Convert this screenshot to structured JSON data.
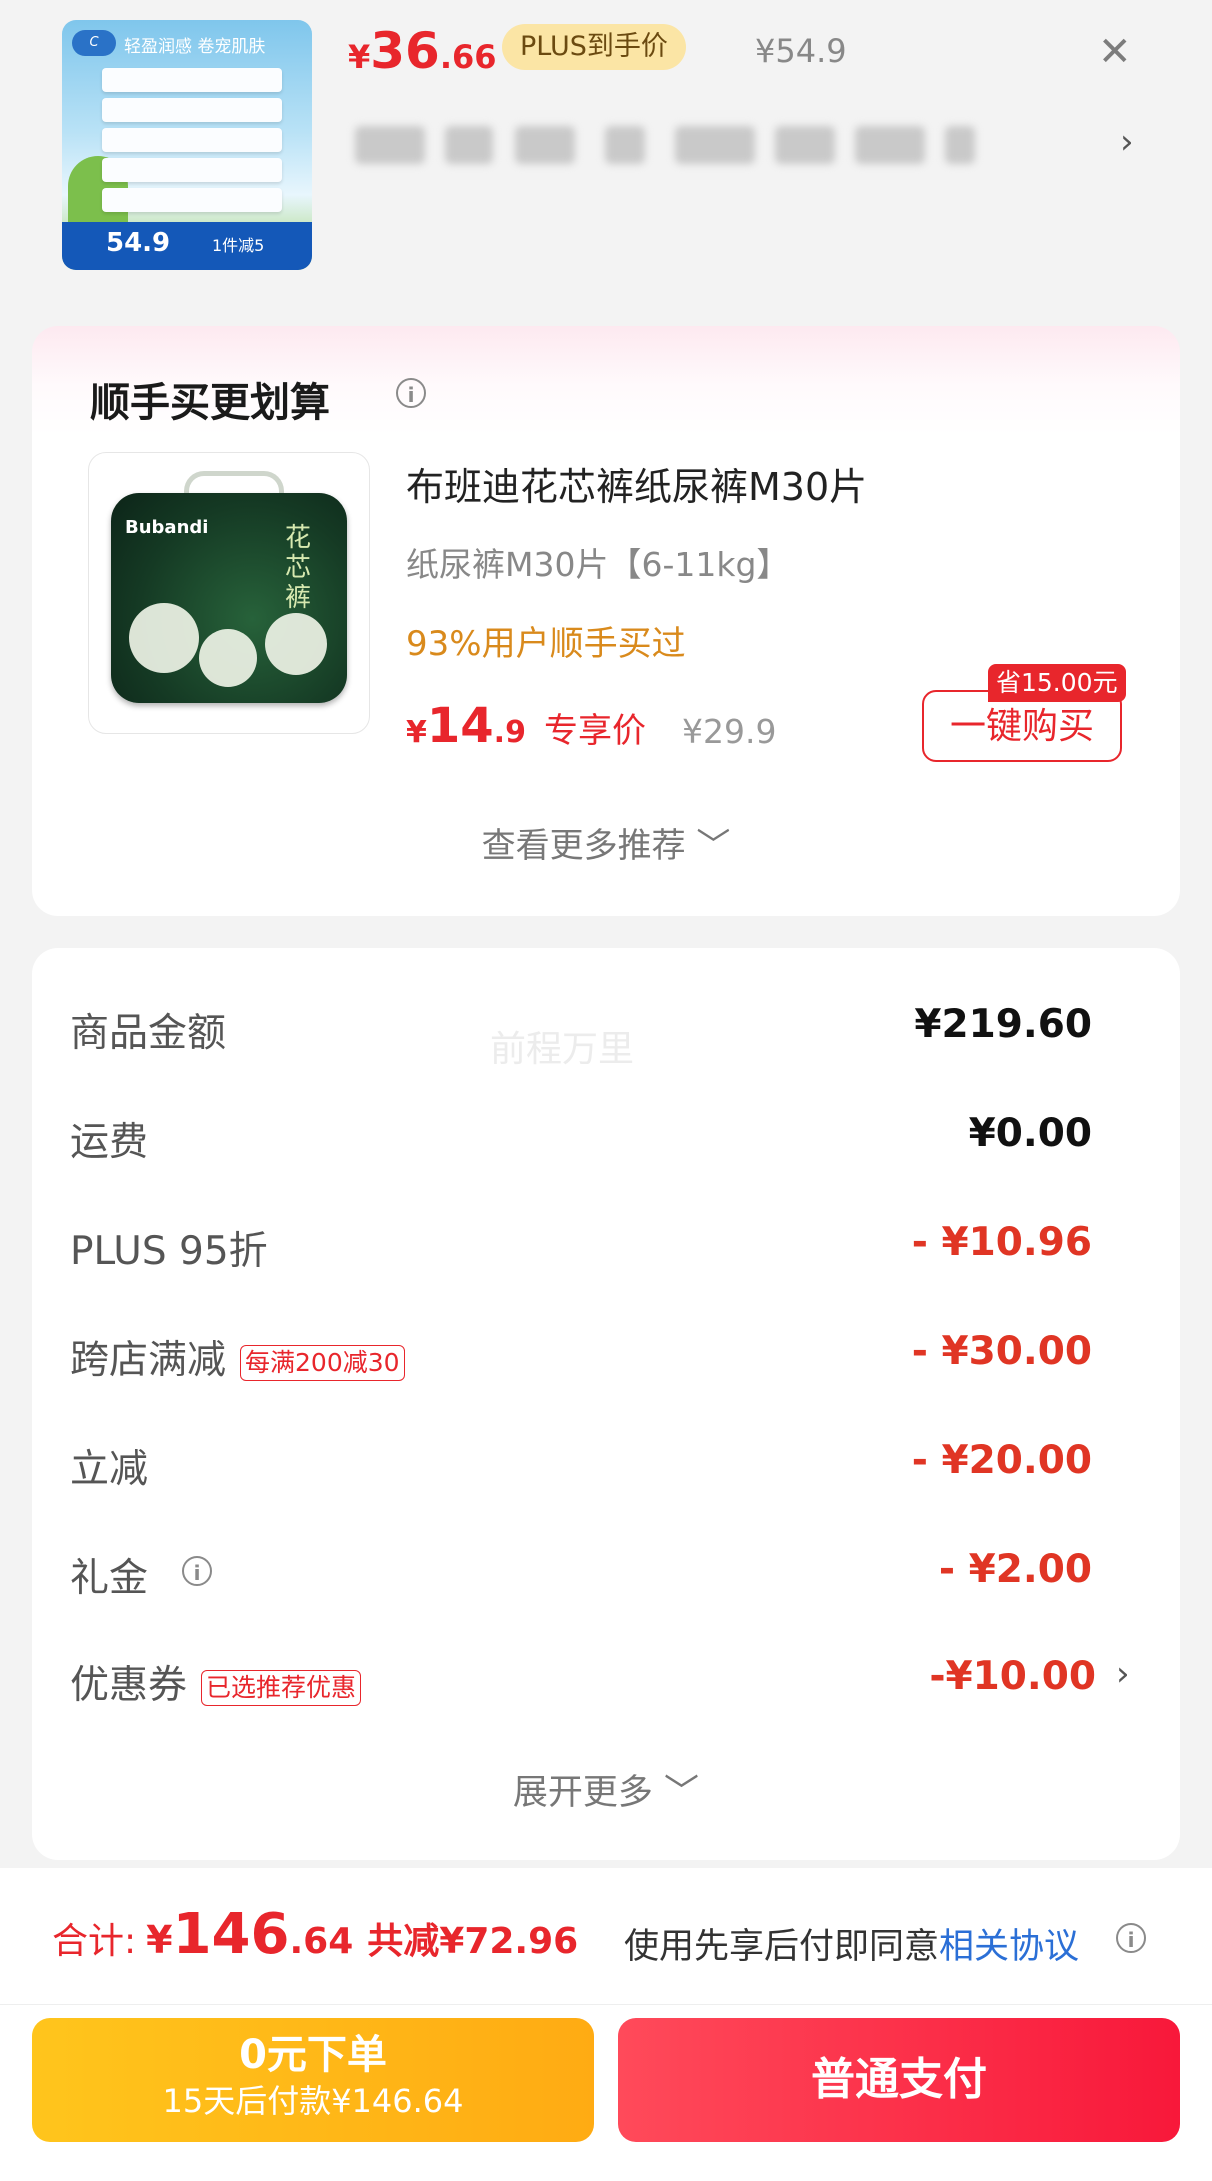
{
  "top_product": {
    "thumb_slogan": "轻盈润感 卷宠肌肤",
    "thumb_price": "54.9",
    "thumb_promo": "1件减5",
    "price_currency": "¥",
    "price_int": "36",
    "price_dec": ".66",
    "plus_badge": "PLUS到手价",
    "orig_price": "¥54.9",
    "close_icon": "close-icon",
    "chevron_icon": "chevron-right-icon"
  },
  "recommend": {
    "title": "顺手买更划算",
    "product_logo": "Bubandi",
    "product_name": "布班迪花芯裤纸尿裤M30片",
    "spec": "纸尿裤M30片【6-11kg】",
    "bought_text": "93%用户顺手买过",
    "price_currency": "¥",
    "price_int": "14",
    "price_dec": ".9",
    "price_label": "专享价",
    "orig_price": "¥29.9",
    "save_tag": "省15.00元",
    "buy_button": "一键购买",
    "see_more": "查看更多推荐 ﹀"
  },
  "summary": {
    "watermark": "前程万里",
    "rows": [
      {
        "label": "商品金额",
        "value": "¥219.60"
      },
      {
        "label": "运费",
        "value": "¥0.00"
      },
      {
        "label": "PLUS 95折",
        "value": "- ¥10.96"
      },
      {
        "label": "跨店满减",
        "tag": "每满200减30",
        "value": "- ¥30.00"
      },
      {
        "label": "立减",
        "value": "- ¥20.00"
      },
      {
        "label": "礼金",
        "value": "- ¥2.00"
      },
      {
        "label": "优惠券",
        "tag": "已选推荐优惠",
        "value": "-¥10.00"
      }
    ],
    "expand_more": "展开更多 ﹀"
  },
  "footer": {
    "total_label": "合计:",
    "total_currency": "¥",
    "total_int": "146",
    "total_dec": ".64",
    "total_saved": "共减¥72.96",
    "agree_text": "使用先享后付即同意",
    "agree_link": "相关协议",
    "zero_button_line1": "0元下单",
    "zero_button_line2": "15天后付款¥146.64",
    "pay_button": "普通支付"
  },
  "colors": {
    "accent_red": "#e8262c",
    "gold": "#d98a1c",
    "link_blue": "#2b6fd6",
    "zero_btn": "#ffb816",
    "pay_btn": "#f8203e"
  }
}
